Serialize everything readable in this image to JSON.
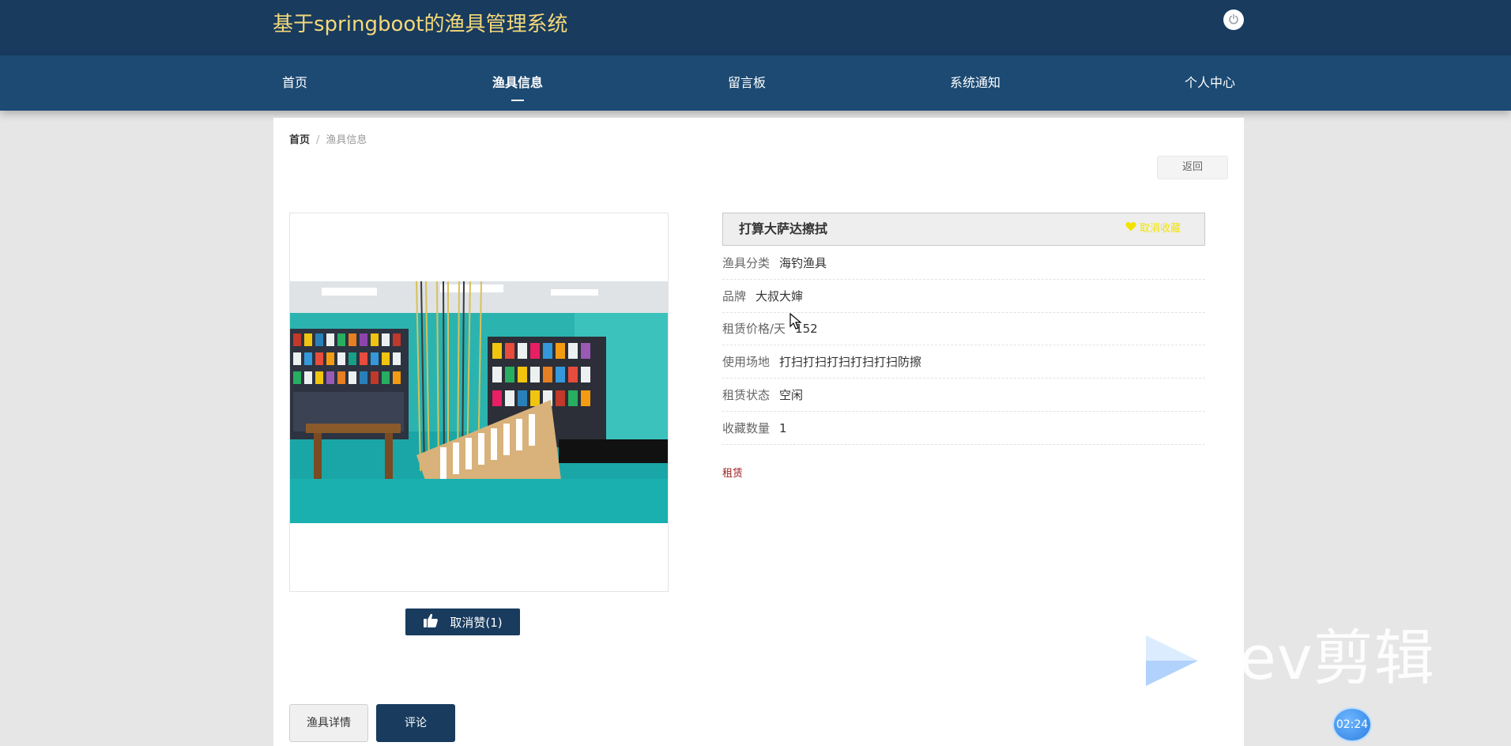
{
  "header": {
    "site_title": "基于springboot的渔具管理系统",
    "power_icon": "power-icon"
  },
  "nav": {
    "items": [
      {
        "label": "首页",
        "active": false
      },
      {
        "label": "渔具信息",
        "active": true
      },
      {
        "label": "留言板",
        "active": false
      },
      {
        "label": "系统通知",
        "active": false
      },
      {
        "label": "个人中心",
        "active": false
      }
    ]
  },
  "breadcrumb": {
    "home": "首页",
    "separator": "/",
    "current": "渔具信息"
  },
  "back_button": "返回",
  "product": {
    "name": "打算大萨达擦拭",
    "collect_label": "取消收藏",
    "collect_icon": "heart-icon",
    "fields": [
      {
        "label": "渔具分类",
        "value": "海钓渔具"
      },
      {
        "label": "品牌",
        "value": "大叔大婶"
      },
      {
        "label": "租赁价格/天",
        "value": "152"
      },
      {
        "label": "使用场地",
        "value": "打扫打扫打扫打扫打扫防擦"
      },
      {
        "label": "租赁状态",
        "value": "空闲"
      },
      {
        "label": "收藏数量",
        "value": "1"
      }
    ],
    "rent_label": "租赁"
  },
  "like_button": {
    "label": "取消赞(1)",
    "icon": "thumbs-up-icon"
  },
  "tabs": {
    "detail": "渔具详情",
    "comment": "评论"
  },
  "overlay": {
    "watermark": "ev剪辑",
    "timer": "02:24"
  },
  "colors": {
    "header_bg": "#183b5e",
    "nav_bg": "#1c4a73",
    "title_color": "#f5d87a",
    "accent": "#183b5e",
    "collect_color": "#f2e400",
    "rent_color": "#9b1b1b"
  }
}
